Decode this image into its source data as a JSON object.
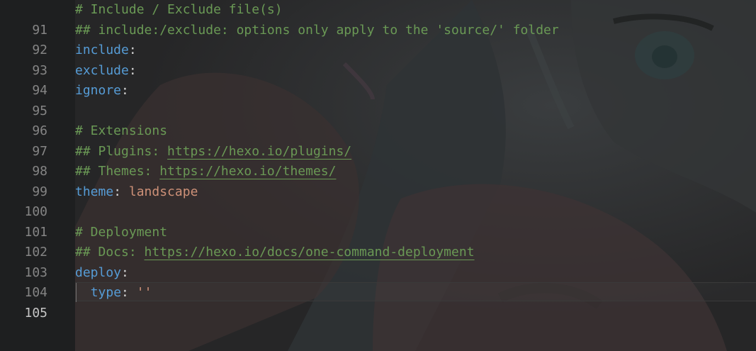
{
  "colors": {
    "comment": "#6a9955",
    "key": "#569cd6",
    "string": "#ce9178",
    "line_number": "#858585",
    "line_number_active": "#c6c6c6"
  },
  "active_line": 105,
  "lines": [
    {
      "number": "91",
      "comment": "# Include / Exclude file(s)"
    },
    {
      "number": "92",
      "comment": "## include:/exclude: options only apply to the 'source/' folder"
    },
    {
      "number": "93",
      "key": "include",
      "colon": ":"
    },
    {
      "number": "94",
      "key": "exclude",
      "colon": ":"
    },
    {
      "number": "95",
      "key": "ignore",
      "colon": ":"
    },
    {
      "number": "96"
    },
    {
      "number": "97",
      "comment": "# Extensions"
    },
    {
      "number": "98",
      "comment_prefix": "## Plugins: ",
      "link": "https://hexo.io/plugins/"
    },
    {
      "number": "99",
      "comment_prefix": "## Themes: ",
      "link": "https://hexo.io/themes/"
    },
    {
      "number": "100",
      "key": "theme",
      "colon": ": ",
      "value": "landscape"
    },
    {
      "number": "101"
    },
    {
      "number": "102",
      "comment": "# Deployment"
    },
    {
      "number": "103",
      "comment_prefix": "## Docs: ",
      "link": "https://hexo.io/docs/one-command-deployment"
    },
    {
      "number": "104",
      "key": "deploy",
      "colon": ":"
    },
    {
      "number": "105",
      "indent": "  ",
      "key": "type",
      "colon": ": ",
      "value": "''"
    }
  ]
}
